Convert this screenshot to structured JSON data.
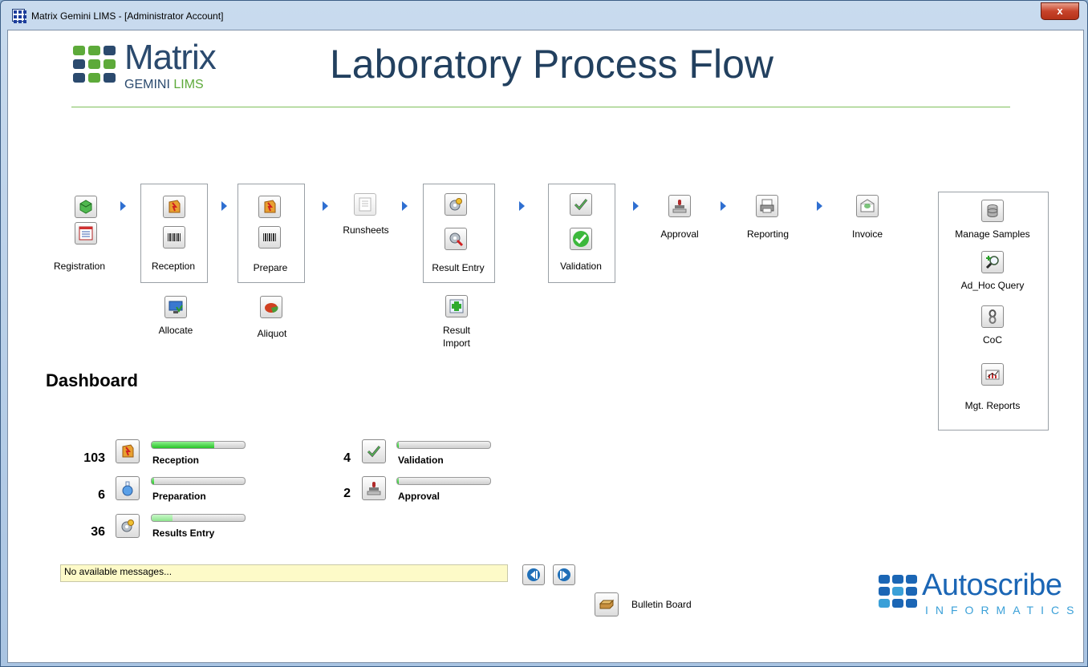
{
  "window": {
    "title": "Matrix Gemini LIMS - [Administrator Account]",
    "close_label": "x"
  },
  "logo": {
    "word": "Matrix",
    "sub_left": "GEMINI",
    "sub_right": "LIMS"
  },
  "header": {
    "title": "Laboratory Process Flow"
  },
  "flow": {
    "registration": "Registration",
    "reception": "Reception",
    "prepare": "Prepare",
    "runsheets": "Runsheets",
    "result_entry": "Result Entry",
    "validation": "Validation",
    "approval": "Approval",
    "reporting": "Reporting",
    "invoice": "Invoice",
    "allocate": "Allocate",
    "aliquot": "Aliquot",
    "result_import_line1": "Result",
    "result_import_line2": "Import"
  },
  "side_panel": {
    "manage_samples": "Manage Samples",
    "ad_hoc_query": "Ad_Hoc Query",
    "coc": "CoC",
    "mgt_reports": "Mgt. Reports"
  },
  "dashboard": {
    "title": "Dashboard",
    "items": [
      {
        "count": "103",
        "label": "Reception",
        "progress": 0.67,
        "icon": "reception-icon"
      },
      {
        "count": "6",
        "label": "Preparation",
        "progress": 0.03,
        "icon": "flask-icon"
      },
      {
        "count": "36",
        "label": "Results Entry",
        "progress": 0.22,
        "icon": "gear-icon"
      },
      {
        "count": "4",
        "label": "Validation",
        "progress": 0.02,
        "icon": "checkmark-icon"
      },
      {
        "count": "2",
        "label": "Approval",
        "progress": 0.01,
        "icon": "stamp-icon"
      }
    ]
  },
  "bulletin": {
    "message": "No available messages...",
    "label": "Bulletin Board"
  },
  "footer_logo": {
    "word": "Autoscribe",
    "sub": "INFORMATICS"
  },
  "colors": {
    "accent_green": "#5daa3a",
    "brand_blue": "#1b66b5",
    "arrow_blue": "#2f6fd1"
  }
}
